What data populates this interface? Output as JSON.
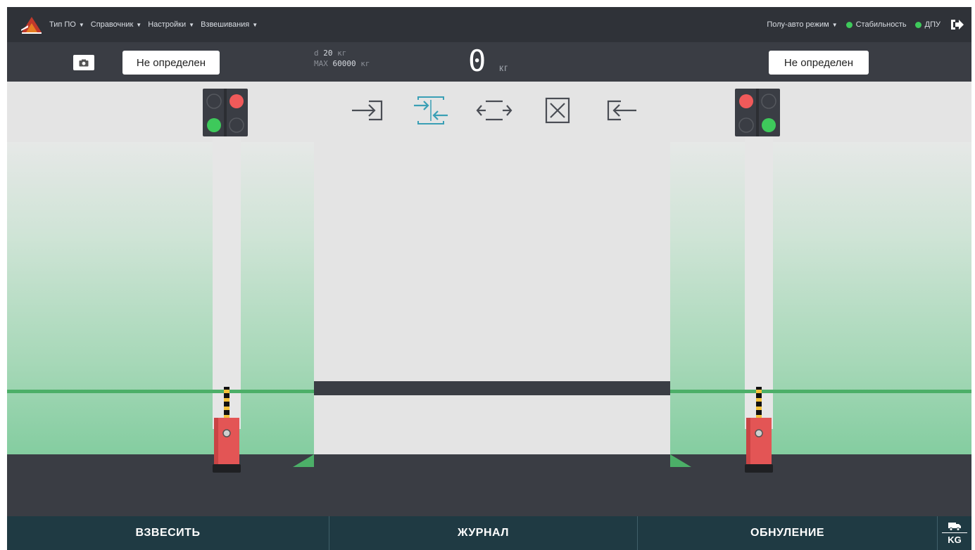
{
  "nav": {
    "menu": [
      {
        "label": "Тип ПО"
      },
      {
        "label": "Справочник"
      },
      {
        "label": "Настройки"
      },
      {
        "label": "Взвешивания"
      }
    ],
    "mode_label": "Полу-авто режим",
    "stability_label": "Стабильность",
    "dpu_label": "ДПУ",
    "status_color": "#3ec95b"
  },
  "infobar": {
    "left_plate": "Не определен",
    "right_plate": "Не определен",
    "d_prefix": "d",
    "d_value": "20",
    "d_unit": "кг",
    "max_prefix": "MAX",
    "max_value": "60000",
    "max_unit": "кг",
    "weight_value": "0",
    "weight_unit": "кг"
  },
  "scene": {
    "icons": [
      "enter-icon",
      "enter-both-icon",
      "pass-through-icon",
      "cancel-icon",
      "exit-icon"
    ],
    "left_light": {
      "top": "red",
      "bottom": "green"
    },
    "right_light": {
      "top": "red",
      "bottom": "green"
    },
    "active_icon_color": "#3a9fb5"
  },
  "bottombar": {
    "weigh_label": "ВЗВЕСИТЬ",
    "journal_label": "ЖУРНАЛ",
    "reset_label": "ОБНУЛЕНИЕ",
    "unit_label": "KG"
  }
}
